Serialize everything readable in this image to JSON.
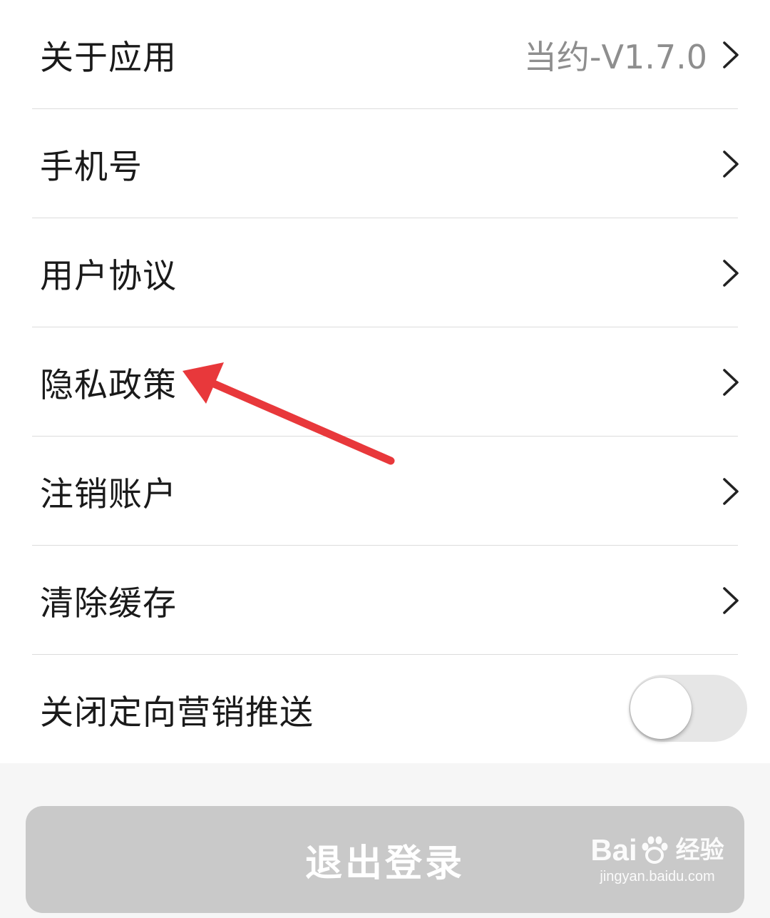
{
  "settings": {
    "about": {
      "label": "关于应用",
      "value": "当约-V1.7.0"
    },
    "phone": {
      "label": "手机号"
    },
    "user_agreement": {
      "label": "用户协议"
    },
    "privacy_policy": {
      "label": "隐私政策"
    },
    "delete_account": {
      "label": "注销账户"
    },
    "clear_cache": {
      "label": "清除缓存"
    },
    "targeted_marketing": {
      "label": "关闭定向营销推送",
      "toggle_on": false
    }
  },
  "logout_label": "退出登录",
  "annotation": {
    "arrow_color": "#e8383b",
    "points_to": "privacy_policy"
  },
  "watermark": {
    "logo": "Baidu",
    "sub": "经验",
    "url": "jingyan.baidu.com"
  },
  "colors": {
    "background": "#f6f6f6",
    "row_bg": "#ffffff",
    "value_text": "#8e8e8e",
    "logout_bg": "#c9c9c9"
  }
}
